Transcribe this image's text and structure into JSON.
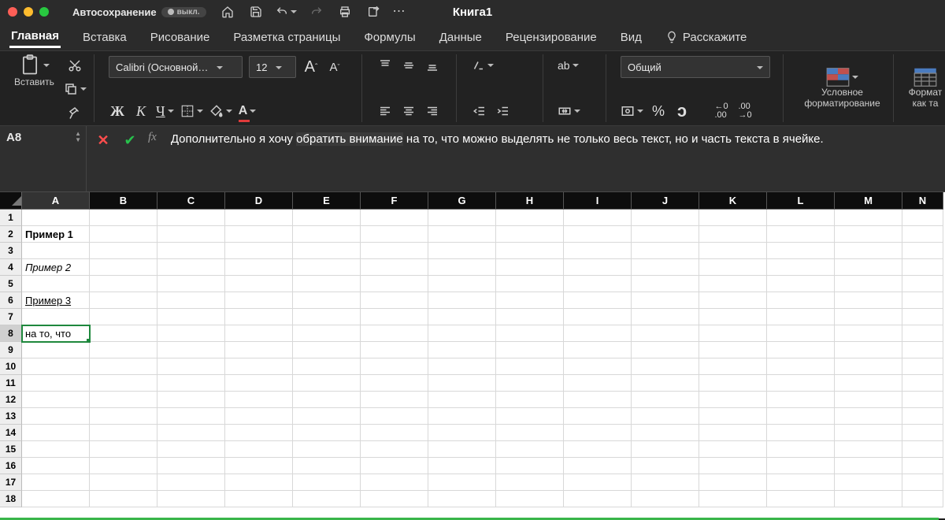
{
  "titlebar": {
    "autosave_label": "Автосохранение",
    "autosave_state": "выкл.",
    "doc_title": "Книга1"
  },
  "tabs": {
    "items": [
      "Главная",
      "Вставка",
      "Рисование",
      "Разметка страницы",
      "Формулы",
      "Данные",
      "Рецензирование",
      "Вид"
    ],
    "tell_me": "Расскажите",
    "active": 0
  },
  "ribbon": {
    "paste_label": "Вставить",
    "font_name": "Calibri (Основной…",
    "font_size": "12",
    "bold": "Ж",
    "italic": "К",
    "underline": "Ч",
    "number_format": "Общий",
    "cond_format": "Условное форматирование",
    "format_as": "Формат как та"
  },
  "formula_bar": {
    "cell_ref": "A8",
    "text_before": "Дополнительно я хочу ",
    "text_highlight": "обратить внимание",
    "text_after": " на то, что можно выделять не только весь текст, но и часть текста в ячейке."
  },
  "grid": {
    "columns": [
      "A",
      "B",
      "C",
      "D",
      "E",
      "F",
      "G",
      "H",
      "I",
      "J",
      "K",
      "L",
      "M",
      "N"
    ],
    "row_count": 18,
    "selected_col": 0,
    "selected_row": 8,
    "cells": {
      "A2": {
        "v": "Пример 1",
        "style": "bold"
      },
      "A4": {
        "v": "Пример 2",
        "style": "italic"
      },
      "A6": {
        "v": "Пример 3",
        "style": "underline"
      },
      "A8": {
        "v": "на то, что",
        "style": ""
      }
    }
  }
}
